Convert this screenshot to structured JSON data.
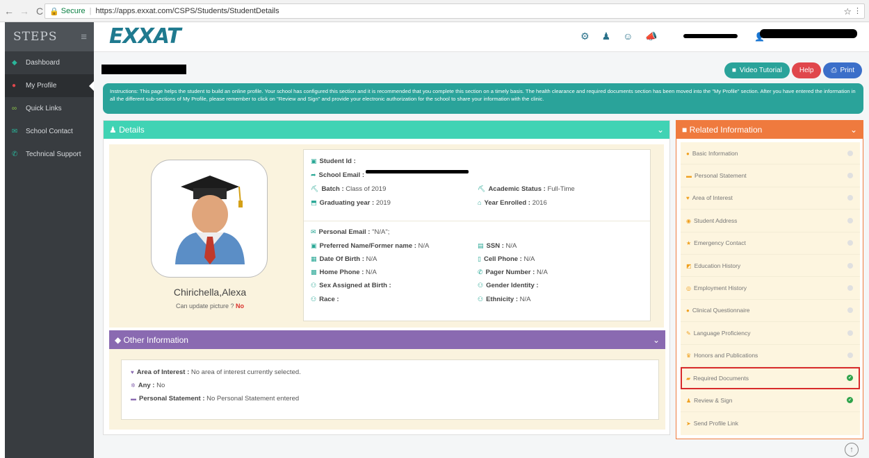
{
  "browser": {
    "secure_label": "Secure",
    "url": "https://apps.exxat.com/CSPS/Students/StudentDetails"
  },
  "sidebar": {
    "logo": "STEPS",
    "items": [
      {
        "label": "Dashboard",
        "icon": "dashboard-icon"
      },
      {
        "label": "My Profile",
        "icon": "user-icon"
      },
      {
        "label": "Quick Links",
        "icon": "link-icon"
      },
      {
        "label": "School Contact",
        "icon": "envelope-icon"
      },
      {
        "label": "Technical Support",
        "icon": "phone-icon"
      }
    ]
  },
  "header": {
    "brand": "EXXAT"
  },
  "actions": {
    "video_tutorial": "Video Tutorial",
    "help": "Help",
    "print": "Print"
  },
  "instructions": "Instructions: This page helps the student to build an online profile. Your school has configured this section and it is recommended that you complete this section on a timely basis. The health clearance and required documents section has been moved into the \"My Profile\" section. After you have entered the information in all the different sub-sections of My Profile, please remember to click on \"Review and Sign\" and provide your electronic authorization for the school to share your information with the clinic.",
  "details": {
    "title": "Details",
    "student_name": "Chirichella,Alexa",
    "can_update_label": "Can update picture ?",
    "can_update_value": "No",
    "fields": {
      "student_id_label": "Student Id :",
      "school_email_label": "School Email :",
      "batch_label": "Batch :",
      "batch_value": "Class of 2019",
      "academic_status_label": "Academic Status :",
      "academic_status_value": "Full-Time",
      "graduating_year_label": "Graduating year :",
      "graduating_year_value": "2019",
      "year_enrolled_label": "Year Enrolled :",
      "year_enrolled_value": "2016",
      "personal_email_label": "Personal Email :",
      "personal_email_value": "\"N/A\";",
      "preferred_name_label": "Preferred Name/Former name :",
      "preferred_name_value": "N/A",
      "ssn_label": "SSN :",
      "ssn_value": "N/A",
      "dob_label": "Date Of Birth :",
      "dob_value": "N/A",
      "cell_phone_label": "Cell Phone :",
      "cell_phone_value": "N/A",
      "home_phone_label": "Home Phone :",
      "home_phone_value": "N/A",
      "pager_label": "Pager Number :",
      "pager_value": "N/A",
      "sex_label": "Sex Assigned at Birth :",
      "gender_label": "Gender Identity :",
      "race_label": "Race :",
      "ethnicity_label": "Ethnicity :",
      "ethnicity_value": "N/A"
    }
  },
  "other": {
    "title": "Other Information",
    "area_label": "Area of Interest :",
    "area_value": "No area of interest currently selected.",
    "any_label": "Any :",
    "any_value": "No",
    "statement_label": "Personal Statement :",
    "statement_value": "No Personal Statement entered"
  },
  "related": {
    "title": "Related Information",
    "items": [
      {
        "label": "Basic Information",
        "status": "pending"
      },
      {
        "label": "Personal Statement",
        "status": "pending"
      },
      {
        "label": "Area of Interest",
        "status": "pending"
      },
      {
        "label": "Student Address",
        "status": "pending"
      },
      {
        "label": "Emergency Contact",
        "status": "pending"
      },
      {
        "label": "Education History",
        "status": "pending"
      },
      {
        "label": "Employment History",
        "status": "pending"
      },
      {
        "label": "Clinical Questionnaire",
        "status": "pending"
      },
      {
        "label": "Language Proficiency",
        "status": "pending"
      },
      {
        "label": "Honors and Publications",
        "status": "pending"
      },
      {
        "label": "Required Documents",
        "status": "complete"
      },
      {
        "label": "Review & Sign",
        "status": "complete"
      },
      {
        "label": "Send Profile Link",
        "status": "none"
      }
    ]
  }
}
